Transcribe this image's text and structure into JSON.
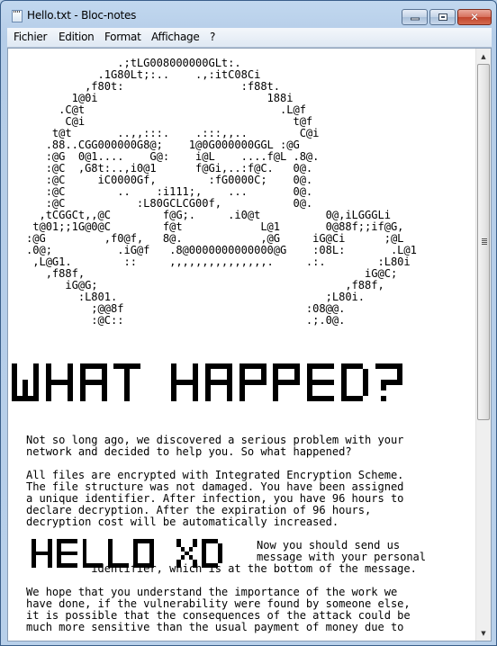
{
  "window": {
    "title": "Hello.txt - Bloc-notes",
    "buttons": {
      "minimize": "minimize",
      "maximize": "maximize",
      "close": "✕"
    }
  },
  "menu": [
    {
      "label": "Fichier"
    },
    {
      "label": "Edition"
    },
    {
      "label": "Format"
    },
    {
      "label": "Affichage"
    },
    {
      "label": "?"
    }
  ],
  "document": {
    "skull_art": "              .;tLG008000000GLt:.\n           .1G80Lt;:..    .,:itC08Ci\n         ,f80t:                  :f88t.\n       1@0i                          188i\n     .C@t                              .L@f\n      C@i                                t@f\n    t@t       ..,,:::.    .:::,,..        C@i\n   .88..CGG000000G8@;    1@0G000000GGL :@G\n   :@G  0@1....    G@:    i@L    ....f@L .8@.\n   :@C  ,G8t:..,i0@1      f@Gi,..:f@C.   0@.\n   :@C     iC0000Gf,        :fG0000C;    0@.\n   :@C        ..    :i111;,    ...       0@.\n   :@C           :L80GCLCG00f,           0@.\n  ,tCGGCt,,@C        f@G;.     .i0@t          0@,iLGGGLi\n t@01;;1G@0@C        f@t            L@1       0@88f;;if@G,\n:@G         ,f0@f,   8@.            ,@G     iG@Ci      ;@L\n.0@;          .iG@f   .8@0000000000000@G    :08L:       .L@1\n ,L@G1.        ::     ,,,,,,,,,,,,,,,.     .:.        :L80i\n   ,f88f,                                           iG@C;\n      iG@G;                                      ,f88f,\n        :L801.                                ;L80i.\n          ;@@8f                            :08@@.\n          :@C::                            .;.0@.",
    "heading1": "WHAT HAPPED?",
    "paragraph1": "Not so long ago, we discovered a serious problem with your\nnetwork and decided to help you. So what happened?",
    "paragraph2": "All files are encrypted with Integrated Encryption Scheme.\nThe file structure was not damaged. You have been assigned\na unique identifier. After infection, you have 96 hours to\ndeclare decryption. After the expiration of 96 hours,\ndecryption cost will be automatically increased.",
    "heading2": "HELLO XD",
    "paragraph3_side": "Now you should send us\nmessage with your personal",
    "paragraph3_tail": "          identifier, which is at the bottom of the message.",
    "paragraph4": "We hope that you understand the importance of the work we\nhave done, if the vulnerability were found by someone else,\nit is possible that the consequences of the attack could be\nmuch more sensitive than the usual payment of money due to"
  },
  "scrollbar": {
    "up_glyph": "▲",
    "down_glyph": "▼",
    "position": 0.0,
    "visible_fraction": 0.6
  }
}
